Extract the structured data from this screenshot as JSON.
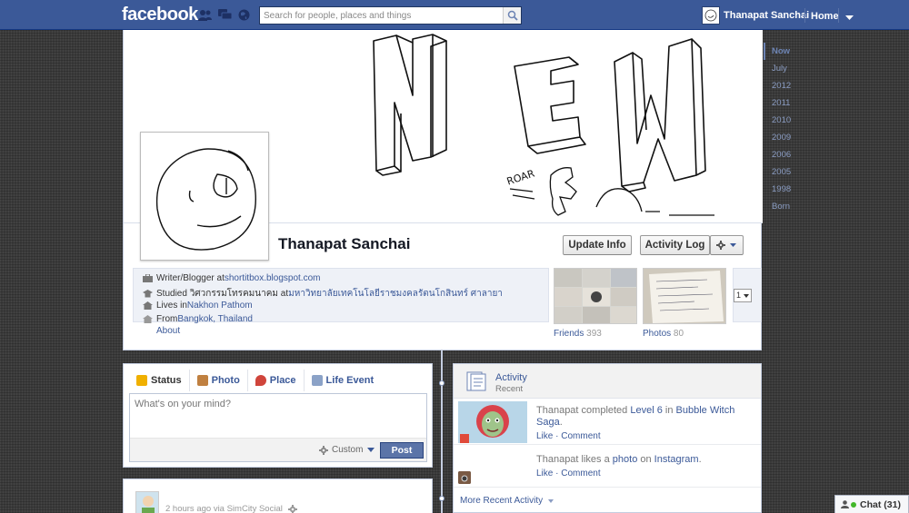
{
  "topbar": {
    "logo": "facebook",
    "search_placeholder": "Search for people, places and things",
    "user_name": "Thanapat Sanchai",
    "home": "Home"
  },
  "cover": {
    "drawing_text": "NEW",
    "roar_text": "ROAR"
  },
  "profile": {
    "name": "Thanapat Sanchai",
    "buttons": {
      "update_info": "Update Info",
      "activity_log": "Activity Log"
    },
    "info": [
      {
        "prefix": "Writer/Blogger at ",
        "link": "shortitbox.blogspot.com",
        "icon": "briefcase-icon"
      },
      {
        "prefix": "Studied วิศวกรรมโทรคมนาคม at ",
        "link": "มหาวิทยาลัยเทคโนโลยีราชมงคลรัตนโกสินทร์ ศาลายา",
        "icon": "graduation-icon"
      },
      {
        "prefix": "Lives in ",
        "link": "Nakhon Pathom",
        "icon": "home-icon"
      },
      {
        "prefix": "From ",
        "link": "Bangkok, Thailand",
        "icon": "pin-icon"
      }
    ],
    "about": "About",
    "friends_label": "Friends",
    "friends_count": "393",
    "photos_label": "Photos",
    "photos_count": "80",
    "more_select_value": "1"
  },
  "scrubber": {
    "years": [
      "Now",
      "July",
      "2012",
      "2011",
      "2010",
      "2009",
      "2006",
      "2005",
      "1998",
      "Born"
    ],
    "active": "Now"
  },
  "composer": {
    "tabs": [
      {
        "label": "Status",
        "icon": "status-icon",
        "color": "#f0b000"
      },
      {
        "label": "Photo",
        "icon": "photo-icon",
        "color": "#c08040"
      },
      {
        "label": "Place",
        "icon": "place-icon",
        "color": "#d0453b"
      },
      {
        "label": "Life Event",
        "icon": "life-event-icon",
        "color": "#8ba2c7"
      }
    ],
    "placeholder": "What's on your mind?",
    "privacy": "Custom",
    "post": "Post"
  },
  "story": {
    "meta": "2 hours ago via SimCity Social"
  },
  "activity": {
    "title": "Activity",
    "subtitle": "Recent",
    "items": [
      {
        "actor": "Thanapat",
        "verb": " completed ",
        "obj": "Level 6",
        "mid": " in ",
        "target": "Bubble Witch Saga",
        "end": ".",
        "like": "Like",
        "comment": "Comment"
      },
      {
        "actor": "Thanapat",
        "verb": " likes a ",
        "obj": "photo",
        "mid": " on ",
        "target": "Instagram",
        "end": ".",
        "like": "Like",
        "comment": "Comment"
      }
    ],
    "more": "More Recent Activity"
  },
  "chat": {
    "label": "Chat",
    "count": "(31)"
  },
  "colors": {
    "brand": "#3b5998",
    "post_button": "#5b74a8",
    "online": "#42b72a"
  }
}
